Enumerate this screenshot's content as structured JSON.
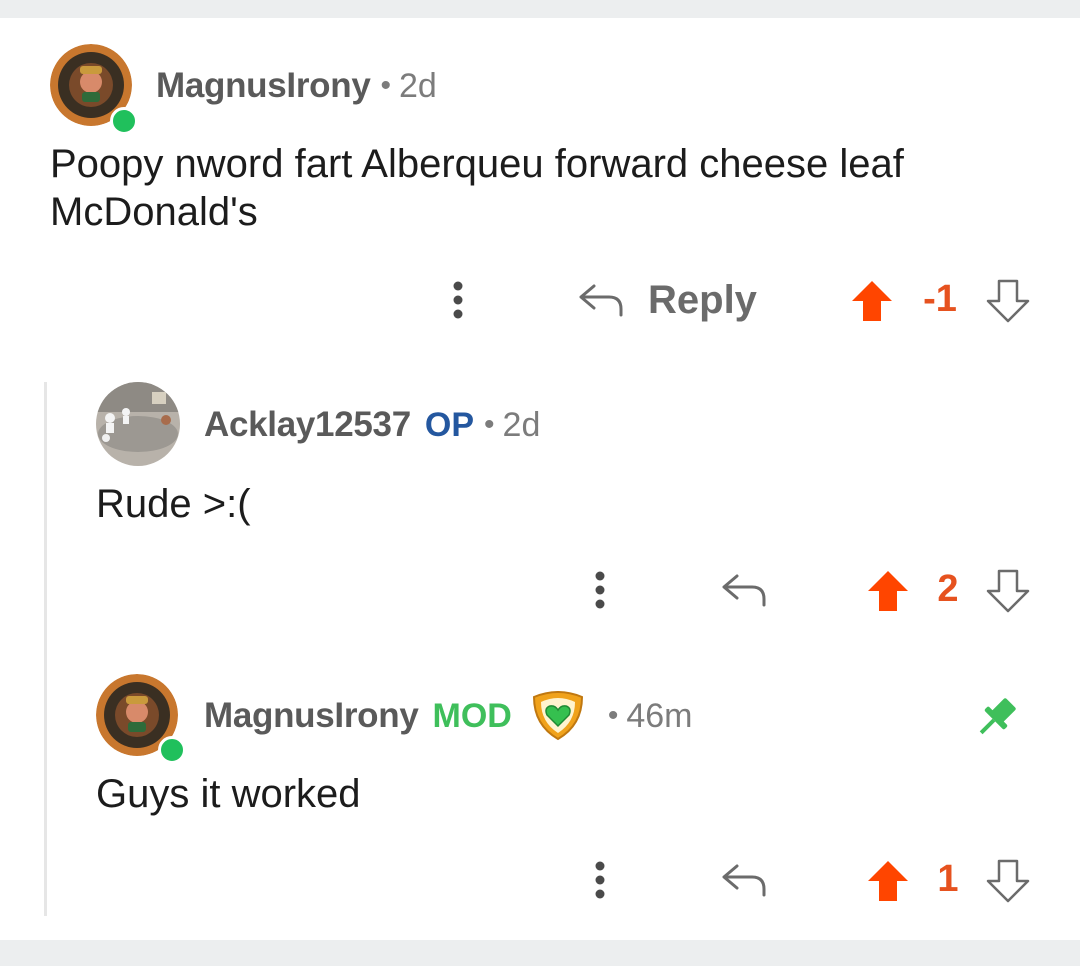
{
  "comments": [
    {
      "username": "MagnusIrony",
      "separator": "•",
      "time": "2d",
      "body_line1": "Poopy nword fart Alberqueu forward cheese leaf",
      "body_line2": "McDonald's",
      "reply_label": "Reply",
      "score": "-1",
      "online": true
    },
    {
      "username": "Acklay12537",
      "op_badge": "OP",
      "separator": "•",
      "time": "2d",
      "body": "Rude >:(",
      "score": "2"
    },
    {
      "username": "MagnusIrony",
      "mod_badge": "MOD",
      "separator": "•",
      "time": "46m",
      "body": "Guys it worked",
      "score": "1",
      "online": true
    }
  ],
  "icons": {
    "more": "more-vertical-icon",
    "reply": "reply-arrow-icon",
    "upvote": "upvote-arrow-icon",
    "downvote": "downvote-arrow-icon",
    "pin": "pin-icon",
    "mod_shield": "mod-shield-icon"
  },
  "colors": {
    "upvoted": "#ff4500",
    "score": "#e6521f",
    "op": "#24579f",
    "mod": "#3fbf5b",
    "online": "#20c05c",
    "pin": "#3fbf5b"
  }
}
